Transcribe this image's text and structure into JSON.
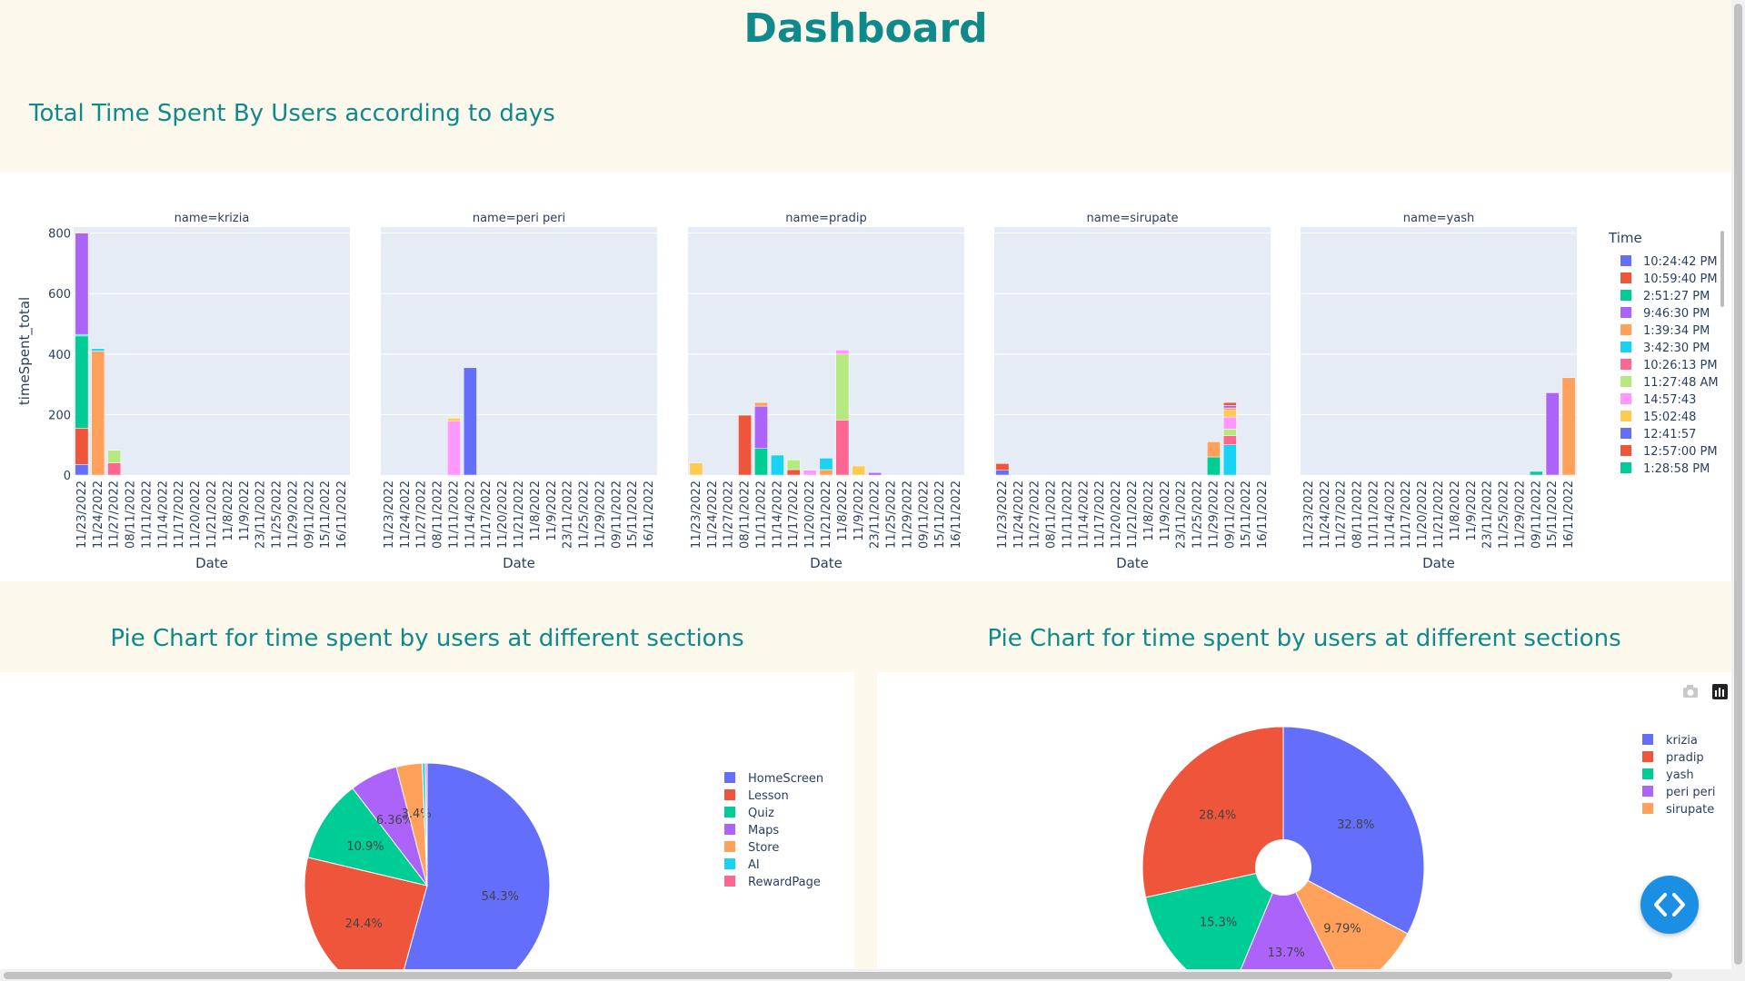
{
  "page": {
    "title": "Dashboard",
    "bar_section_title": "Total Time Spent By Users according to days",
    "pie_titles": [
      "Pie Chart for time spent by users at different sections",
      "Pie Chart for time spent by users at different sections"
    ]
  },
  "colors": {
    "accent": "#0e8a8a",
    "background": "#fdf8ec",
    "plot_bg": "#e5ecf6",
    "palette": [
      "#636efa",
      "#ef553b",
      "#00cc96",
      "#ab63fa",
      "#ffa15a",
      "#19d3f3",
      "#ff6692",
      "#b6e880",
      "#ff97ff",
      "#fecb52"
    ]
  },
  "icons": {
    "camera": "camera-icon",
    "plotly": "plotly-logo-icon",
    "code": "code-brackets-icon"
  },
  "chart_data": [
    {
      "type": "bar",
      "stacked": true,
      "facet_by": "name",
      "ylabel": "timeSpent_total",
      "xlabel": "Date",
      "ylim": [
        0,
        820
      ],
      "yticks": [
        0,
        200,
        400,
        600,
        800
      ],
      "grid": true,
      "legend": {
        "title": "Time",
        "placement": "right",
        "entries": [
          "10:24:42 PM",
          "10:59:40 PM",
          "2:51:27 PM",
          "9:46:30 PM",
          "1:39:34 PM",
          "3:42:30 PM",
          "10:26:13 PM",
          "11:27:48 AM",
          "14:57:43",
          "15:02:48",
          "12:41:57",
          "12:57:00 PM",
          "1:28:58 PM"
        ]
      },
      "categories": [
        "11/23/2022",
        "11/24/2022",
        "11/27/2022",
        "08/11/2022",
        "11/11/2022",
        "11/14/2022",
        "11/17/2022",
        "11/20/2022",
        "11/21/2022",
        "11/8/2022",
        "11/9/2022",
        "23/11/2022",
        "11/25/2022",
        "11/29/2022",
        "09/11/2022",
        "15/11/2022",
        "16/11/2022"
      ],
      "facets": [
        {
          "label": "name=krizia",
          "stacks": [
            {
              "x": "11/23/2022",
              "segments": [
                {
                  "color_index": 0,
                  "value": 35
                },
                {
                  "color_index": 1,
                  "value": 120
                },
                {
                  "color_index": 2,
                  "value": 305
                },
                {
                  "color_index": 5,
                  "value": 5
                },
                {
                  "color_index": 3,
                  "value": 335
                }
              ]
            },
            {
              "x": "11/24/2022",
              "segments": [
                {
                  "color_index": 4,
                  "value": 410
                },
                {
                  "color_index": 5,
                  "value": 8
                }
              ]
            },
            {
              "x": "11/27/2022",
              "segments": [
                {
                  "color_index": 6,
                  "value": 40
                },
                {
                  "color_index": 7,
                  "value": 42
                }
              ]
            }
          ]
        },
        {
          "label": "name=peri  peri",
          "stacks": [
            {
              "x": "11/11/2022",
              "segments": [
                {
                  "color_index": 8,
                  "value": 178
                },
                {
                  "color_index": 9,
                  "value": 10
                }
              ]
            },
            {
              "x": "11/14/2022",
              "segments": [
                {
                  "color_index": 0,
                  "value": 355
                }
              ]
            }
          ]
        },
        {
          "label": "name=pradip",
          "stacks": [
            {
              "x": "11/23/2022",
              "segments": [
                {
                  "color_index": 9,
                  "value": 40
                }
              ]
            },
            {
              "x": "08/11/2022",
              "segments": [
                {
                  "color_index": 1,
                  "value": 198
                }
              ]
            },
            {
              "x": "11/11/2022",
              "segments": [
                {
                  "color_index": 2,
                  "value": 88
                },
                {
                  "color_index": 3,
                  "value": 140
                },
                {
                  "color_index": 4,
                  "value": 12
                }
              ]
            },
            {
              "x": "11/14/2022",
              "segments": [
                {
                  "color_index": 5,
                  "value": 66
                }
              ]
            },
            {
              "x": "11/17/2022",
              "segments": [
                {
                  "color_index": 1,
                  "value": 18
                },
                {
                  "color_index": 7,
                  "value": 32
                }
              ]
            },
            {
              "x": "11/20/2022",
              "segments": [
                {
                  "color_index": 8,
                  "value": 16
                }
              ]
            },
            {
              "x": "11/21/2022",
              "segments": [
                {
                  "color_index": 4,
                  "value": 18
                },
                {
                  "color_index": 5,
                  "value": 38
                }
              ]
            },
            {
              "x": "11/8/2022",
              "segments": [
                {
                  "color_index": 6,
                  "value": 182
                },
                {
                  "color_index": 7,
                  "value": 218
                },
                {
                  "color_index": 8,
                  "value": 14
                }
              ]
            },
            {
              "x": "11/9/2022",
              "segments": [
                {
                  "color_index": 9,
                  "value": 30
                }
              ]
            },
            {
              "x": "23/11/2022",
              "segments": [
                {
                  "color_index": 3,
                  "value": 8
                }
              ]
            }
          ]
        },
        {
          "label": "name=sirupate",
          "stacks": [
            {
              "x": "11/23/2022",
              "segments": [
                {
                  "color_index": 0,
                  "value": 16
                },
                {
                  "color_index": 1,
                  "value": 22
                }
              ]
            },
            {
              "x": "11/29/2022",
              "segments": [
                {
                  "color_index": 2,
                  "value": 60
                },
                {
                  "color_index": 4,
                  "value": 50
                }
              ]
            },
            {
              "x": "09/11/2022",
              "segments": [
                {
                  "color_index": 5,
                  "value": 100
                },
                {
                  "color_index": 6,
                  "value": 30
                },
                {
                  "color_index": 7,
                  "value": 22
                },
                {
                  "color_index": 8,
                  "value": 40
                },
                {
                  "color_index": 9,
                  "value": 22
                },
                {
                  "color_index": 4,
                  "value": 8
                },
                {
                  "color_index": 3,
                  "value": 8
                },
                {
                  "color_index": 1,
                  "value": 10
                }
              ]
            }
          ]
        },
        {
          "label": "name=yash",
          "stacks": [
            {
              "x": "09/11/2022",
              "segments": [
                {
                  "color_index": 2,
                  "value": 12
                }
              ]
            },
            {
              "x": "15/11/2022",
              "segments": [
                {
                  "color_index": 3,
                  "value": 272
                }
              ]
            },
            {
              "x": "16/11/2022",
              "segments": [
                {
                  "color_index": 4,
                  "value": 322
                }
              ]
            }
          ]
        }
      ]
    },
    {
      "type": "pie",
      "labels": [
        "HomeScreen",
        "Lesson",
        "Quiz",
        "Maps",
        "Store",
        "AI",
        "RewardPage"
      ],
      "values": [
        54.3,
        24.4,
        10.9,
        6.36,
        3.4,
        0.4,
        0.24
      ],
      "value_labels": [
        "54.3%",
        "24.4%",
        "10.9%",
        "6.36%",
        "3.4%",
        "",
        ""
      ],
      "legend_placement": "right"
    },
    {
      "type": "pie",
      "hole": 0.2,
      "labels": [
        "krizia",
        "pradip",
        "yash",
        "peri  peri",
        "sirupate"
      ],
      "values": [
        32.8,
        28.4,
        15.3,
        13.7,
        9.79
      ],
      "order": [
        "krizia",
        "sirupate",
        "peri  peri",
        "yash",
        "pradip"
      ],
      "value_labels": [
        "32.8%",
        "28.4%",
        "15.3%",
        "13.7%",
        "9.79%"
      ],
      "legend_placement": "right"
    }
  ]
}
